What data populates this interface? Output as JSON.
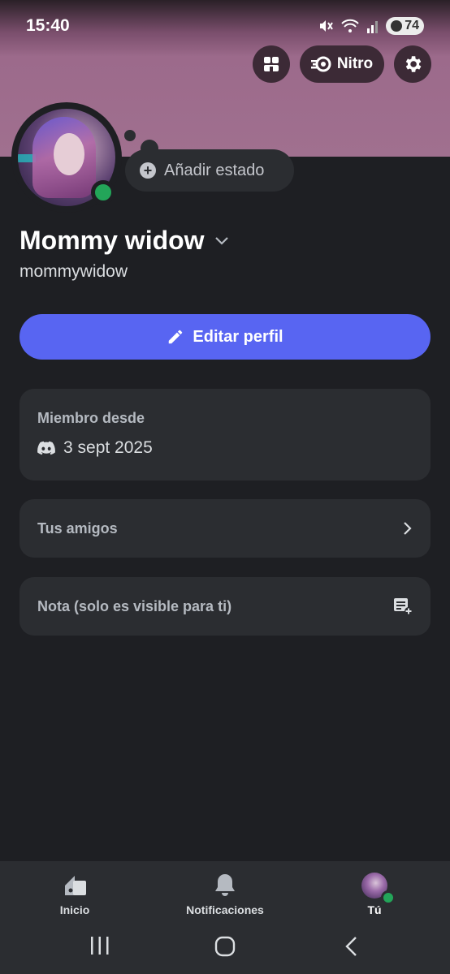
{
  "status_bar": {
    "time": "15:40",
    "battery": "74"
  },
  "header": {
    "nitro_label": "Nitro"
  },
  "profile": {
    "status_button": "Añadir estado",
    "display_name": "Mommy widow",
    "username": "mommywidow",
    "online_color": "#23a559"
  },
  "actions": {
    "edit_profile": "Editar perfil",
    "accent": "#5865f2"
  },
  "member_card": {
    "label": "Miembro desde",
    "date": "3 sept 2025"
  },
  "friends_card": {
    "label": "Tus amigos"
  },
  "note_card": {
    "label": "Nota (solo es visible para ti)"
  },
  "bottom_nav": {
    "items": [
      {
        "label": "Inicio",
        "icon": "home-icon"
      },
      {
        "label": "Notificaciones",
        "icon": "bell-icon"
      },
      {
        "label": "Tú",
        "icon": "avatar"
      }
    ]
  }
}
